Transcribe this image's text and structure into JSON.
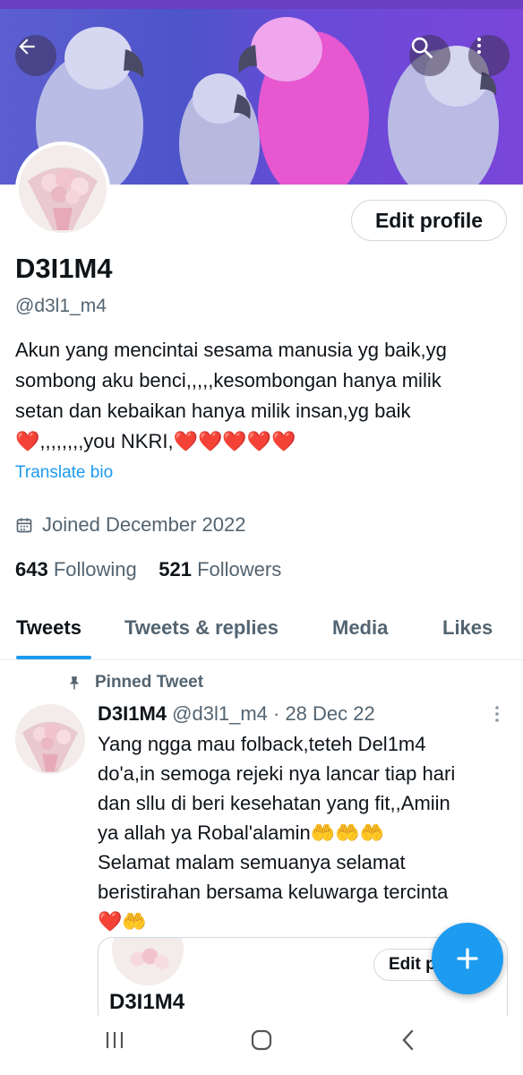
{
  "header": {
    "back_icon": "arrow-left-icon",
    "search_icon": "search-icon",
    "more_icon": "more-vertical-icon"
  },
  "profile": {
    "edit_label": "Edit profile",
    "display_name": "D3I1M4",
    "handle": "@d3l1_m4",
    "bio_lines": [
      "Akun yang mencintai sesama manusia yg baik,yg",
      "sombong aku benci,,,,,kesombongan hanya milik",
      "setan dan kebaikan hanya milik insan,yg baik",
      ",,,,,,,,you  NKRI,"
    ],
    "translate_label": "Translate bio",
    "joined": "Joined December 2022",
    "following_count": "643",
    "following_label": "Following",
    "followers_count": "521",
    "followers_label": "Followers"
  },
  "tabs": [
    {
      "label": "Tweets",
      "active": true
    },
    {
      "label": "Tweets & replies",
      "active": false
    },
    {
      "label": "Media",
      "active": false
    },
    {
      "label": "Likes",
      "active": false
    }
  ],
  "pinned_tweet": {
    "pinned_label": "Pinned Tweet",
    "author": "D3I1M4",
    "meta": "@d3l1_m4 · 28 Dec 22",
    "text_lines": [
      "Yang ngga mau folback,teteh Del1m4",
      "do'a,in semoga rejeki nya lancar tiap hari",
      "dan sllu di beri kesehatan yang fit,,Amiin",
      "ya allah ya Robal'alamin",
      "Selamat malam semuanya selamat",
      "beristirahan bersama keluwarga tercinta"
    ],
    "card": {
      "edit_label": "Edit p",
      "name": "D3I1M4"
    }
  },
  "colors": {
    "accent": "#1d9bf0",
    "secondary_text": "#536471",
    "heart": "#e0182d"
  }
}
